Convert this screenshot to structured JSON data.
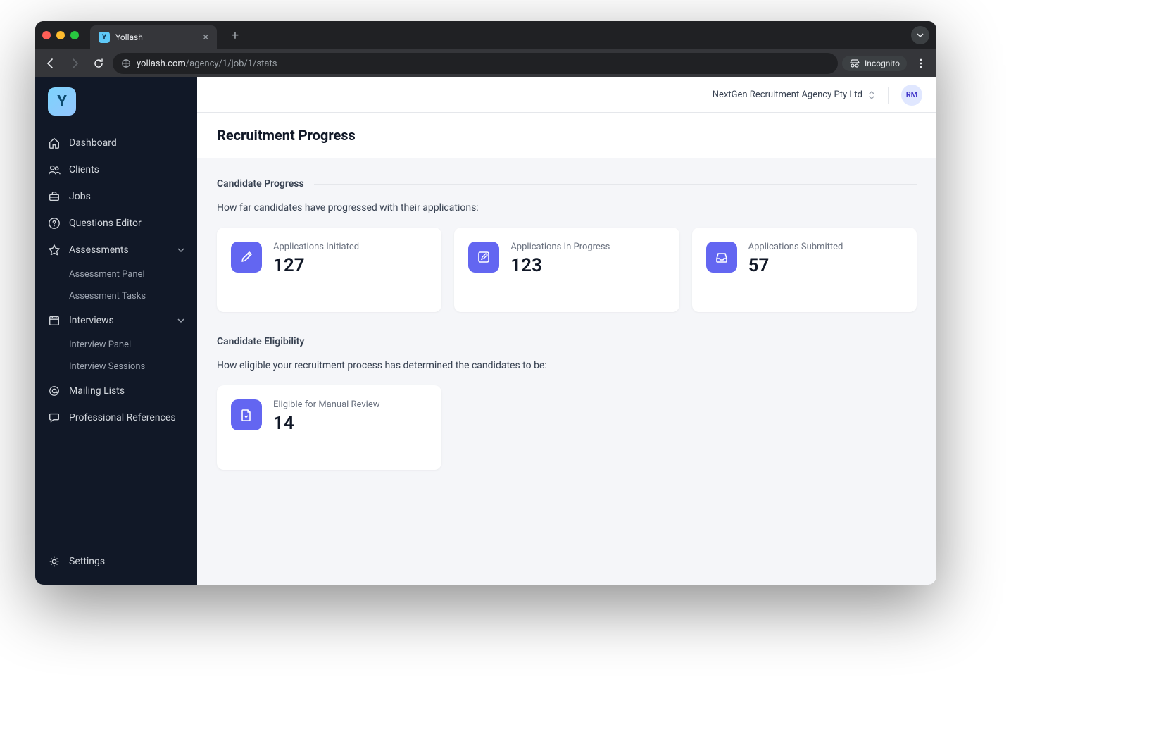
{
  "browser": {
    "tab_title": "Yollash",
    "url_domain": "yollash.com",
    "url_path": "/agency/1/job/1/stats",
    "incognito_label": "Incognito"
  },
  "sidebar": {
    "logo_letter": "Y",
    "items": [
      {
        "label": "Dashboard",
        "icon": "home-icon"
      },
      {
        "label": "Clients",
        "icon": "users-icon"
      },
      {
        "label": "Jobs",
        "icon": "briefcase-icon"
      },
      {
        "label": "Questions Editor",
        "icon": "question-icon"
      },
      {
        "label": "Assessments",
        "icon": "star-icon",
        "expanded": true,
        "children": [
          "Assessment Panel",
          "Assessment Tasks"
        ]
      },
      {
        "label": "Interviews",
        "icon": "calendar-icon",
        "expanded": true,
        "children": [
          "Interview Panel",
          "Interview Sessions"
        ]
      },
      {
        "label": "Mailing Lists",
        "icon": "at-icon"
      },
      {
        "label": "Professional References",
        "icon": "chat-icon"
      }
    ],
    "settings_label": "Settings"
  },
  "header": {
    "agency_name": "NextGen Recruitment Agency Pty Ltd",
    "user_initials": "RM"
  },
  "page": {
    "title": "Recruitment Progress",
    "sections": [
      {
        "heading": "Candidate Progress",
        "description": "How far candidates have progressed with their applications:",
        "cards": [
          {
            "label": "Applications Initiated",
            "value": "127",
            "icon": "pencil-icon"
          },
          {
            "label": "Applications In Progress",
            "value": "123",
            "icon": "edit-square-icon"
          },
          {
            "label": "Applications Submitted",
            "value": "57",
            "icon": "inbox-icon"
          }
        ]
      },
      {
        "heading": "Candidate Eligibility",
        "description": "How eligible your recruitment process has determined the candidates to be:",
        "cards": [
          {
            "label": "Eligible for Manual Review",
            "value": "14",
            "icon": "file-icon"
          }
        ]
      }
    ]
  }
}
